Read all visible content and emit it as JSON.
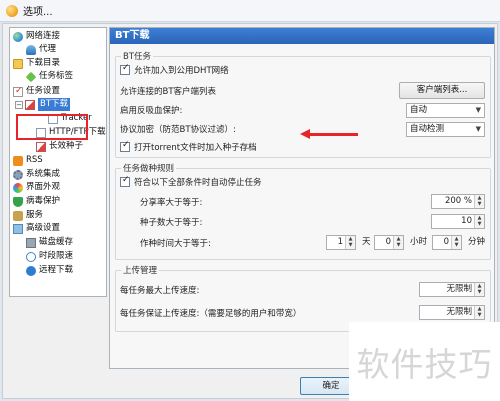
{
  "window": {
    "title": "选项..."
  },
  "sidebar": {
    "items": [
      {
        "label": "网络连接",
        "icon": "globe-icon",
        "level": 0
      },
      {
        "label": "代理",
        "icon": "proxy-icon",
        "level": 1
      },
      {
        "label": "下载目录",
        "icon": "folder-icon",
        "level": 0
      },
      {
        "label": "任务标签",
        "icon": "tag-icon",
        "level": 1
      },
      {
        "label": "任务设置",
        "icon": "task-settings-icon",
        "level": 0
      },
      {
        "label": "BT下载",
        "icon": "bt-icon",
        "level": 1,
        "selected": true
      },
      {
        "label": "Tracker",
        "icon": "tracker-icon",
        "level": 2
      },
      {
        "label": "HTTP/FTP下载",
        "icon": "http-ftp-icon",
        "level": 1
      },
      {
        "label": "长效种子",
        "icon": "seed-icon",
        "level": 1
      },
      {
        "label": "RSS",
        "icon": "rss-icon",
        "level": 0
      },
      {
        "label": "系统集成",
        "icon": "system-icon",
        "level": 0
      },
      {
        "label": "界面外观",
        "icon": "palette-icon",
        "level": 0
      },
      {
        "label": "病毒保护",
        "icon": "shield-icon",
        "level": 0
      },
      {
        "label": "服务",
        "icon": "service-icon",
        "level": 0
      },
      {
        "label": "高级设置",
        "icon": "advanced-icon",
        "level": 0
      },
      {
        "label": "磁盘缓存",
        "icon": "disk-icon",
        "level": 1
      },
      {
        "label": "时段限速",
        "icon": "clock-icon",
        "level": 1
      },
      {
        "label": "远程下载",
        "icon": "remote-icon",
        "level": 1
      }
    ]
  },
  "panel": {
    "header": "BT下载",
    "bt_group": {
      "title": "BT任务",
      "dht_checkbox": {
        "label": "允许加入到公用DHT网络",
        "checked": true
      },
      "allowed_clients_label": "允许连接的BT客户端列表",
      "clients_button": "客户端列表...",
      "leech_label": "启用反吸血保护:",
      "leech_value": "自动",
      "encryption_label": "协议加密（防范BT协议过滤）:",
      "encryption_value": "自动检测",
      "torrent_checkbox": {
        "label": "打开torrent文件时加入种子存档",
        "checked": true
      }
    },
    "seeding_group": {
      "title": "任务做种规则",
      "stop_checkbox": {
        "label": "符合以下全部条件时自动停止任务",
        "checked": true
      },
      "share_ratio_label": "分享率大于等于:",
      "share_ratio_value": "200 %",
      "seeds_label": "种子数大于等于:",
      "seeds_value": "10",
      "time_label": "作种时间大于等于:",
      "days_value": "1",
      "days_unit": "天",
      "hours_value": "0",
      "hours_unit": "小时",
      "minutes_value": "0",
      "minutes_unit": "分钟"
    },
    "upload_group": {
      "title": "上传管理",
      "max_upload_label": "每任务最大上传速度:",
      "max_upload_value": "无限制",
      "guarantee_upload_label": "每任务保证上传速度:（需要足够的用户和带宽）",
      "guarantee_upload_value": "无限制"
    }
  },
  "footer": {
    "ok_label": "确定"
  },
  "watermark": {
    "text": "软件技巧"
  },
  "colors": {
    "accent": "#2a64b8",
    "highlight": "#e8242b"
  }
}
